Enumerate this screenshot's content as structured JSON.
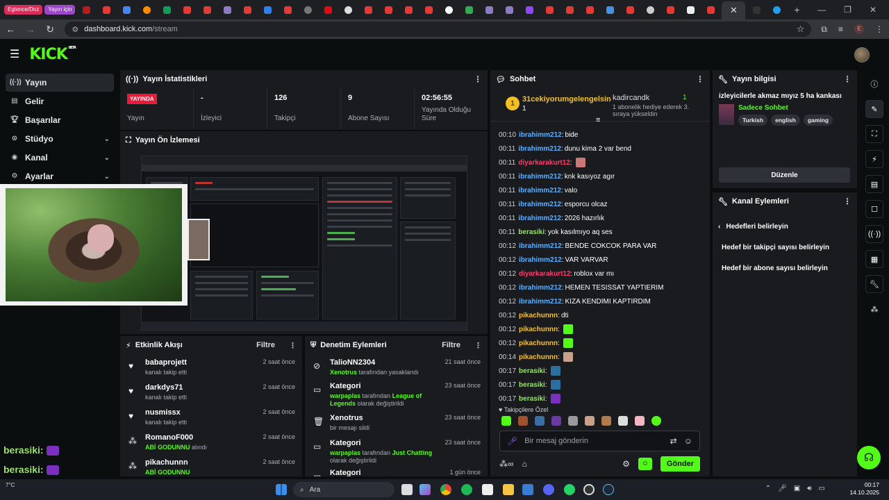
{
  "browser": {
    "tab_pills": [
      {
        "label": "Eglence/Doz",
        "color": "#d62d5b"
      },
      {
        "label": "Yayın için",
        "color": "#9c46c8"
      }
    ],
    "active_tab_label": "✕",
    "url_host": "dashboard.kick.com",
    "url_path": "/stream",
    "profile_initial": "E"
  },
  "sidebar": {
    "items": [
      {
        "label": "Yayın",
        "icon": "broadcast-icon"
      },
      {
        "label": "Gelir",
        "icon": "income-icon"
      },
      {
        "label": "Başarılar",
        "icon": "trophy-icon"
      },
      {
        "label": "Stüdyo",
        "icon": "studio-icon"
      },
      {
        "label": "Kanal",
        "icon": "channel-icon"
      },
      {
        "label": "Ayarlar",
        "icon": "gear-icon"
      }
    ]
  },
  "stats": {
    "title": "Yayın İstatistikleri",
    "live_badge": "YAYINDA",
    "live_label": "Yayın",
    "viewers_value": "-",
    "viewers_label": "İzleyici",
    "followers_value": "126",
    "followers_label": "Takipçi",
    "subs_value": "9",
    "subs_label": "Abone Sayısı",
    "uptime_value": "02:56:55",
    "uptime_label": "Yayında Olduğu Süre"
  },
  "preview": {
    "title": "Yayın Ön İzlemesi"
  },
  "activity": {
    "title": "Etkinlik Akışı",
    "filter": "Filtre",
    "items": [
      {
        "user": "babaprojett",
        "text": "kanalı takip etti",
        "highlight": "",
        "time": "2 saat önce",
        "icon": "heart-icon"
      },
      {
        "user": "darkdys71",
        "text": "kanalı takip etti",
        "highlight": "",
        "time": "2 saat önce",
        "icon": "heart-icon"
      },
      {
        "user": "nusmissx",
        "text": "kanalı takip etti",
        "highlight": "",
        "time": "2 saat önce",
        "icon": "heart-icon"
      },
      {
        "user": "RomanoF000",
        "text": "alındı",
        "highlight": "ABİ GODUNNU",
        "time": "2 saat önce",
        "icon": "points-icon"
      },
      {
        "user": "pikachunnn",
        "text": "",
        "highlight": "ABİ GODUNNU",
        "time": "2 saat önce",
        "icon": "points-icon"
      }
    ]
  },
  "moderation": {
    "title": "Denetim Eylemleri",
    "filter": "Filtre",
    "items": [
      {
        "user": "TalioNN2304",
        "pre": "",
        "hl1": "Xenotrus",
        "mid": "tarafından yasaklandı",
        "hl2": "",
        "post": "",
        "time": "21 saat önce",
        "icon": "ban-icon"
      },
      {
        "user": "Kategori",
        "pre": "",
        "hl1": "warpaplas",
        "mid": "tarafından",
        "hl2": "League of Legends",
        "post": "olarak değiştirildi",
        "time": "23 saat önce",
        "icon": "category-icon"
      },
      {
        "user": "Xenotrus",
        "pre": "bir mesajı sildi",
        "hl1": "",
        "mid": "",
        "hl2": "",
        "post": "",
        "time": "23 saat önce",
        "icon": "trash-icon"
      },
      {
        "user": "Kategori",
        "pre": "",
        "hl1": "warpaplas",
        "mid": "tarafından",
        "hl2": "Just Chatting",
        "post": "olarak değiştirildi",
        "time": "23 saat önce",
        "icon": "category-icon"
      },
      {
        "user": "Kategori",
        "pre": "",
        "hl1": "",
        "mid": "",
        "hl2": "",
        "post": "",
        "time": "1 gün önce",
        "icon": "category-icon"
      }
    ]
  },
  "chat": {
    "title": "Sohbet",
    "pinned": {
      "rank": "1",
      "user": "31cekiyorumgelengelsin",
      "level": "1",
      "gift_user": "kadircandk",
      "gift_level": "1",
      "gift_text": "1 abonelik hediye ederek 3. sıraya yükseldin"
    },
    "messages": [
      {
        "time": "00:10",
        "user": "ibrahimm212",
        "color": "#5ab0ff",
        "text": "bide",
        "emote": ""
      },
      {
        "time": "00:11",
        "user": "ibrahimm212",
        "color": "#5ab0ff",
        "text": "dunu kima 2 var bend",
        "emote": ""
      },
      {
        "time": "00:11",
        "user": "diyarkarakurt12",
        "color": "#ff3b6b",
        "text": "",
        "emote": "#c77"
      },
      {
        "time": "00:11",
        "user": "ibrahimm212",
        "color": "#5ab0ff",
        "text": "knk kasıyoz agır",
        "emote": ""
      },
      {
        "time": "00:11",
        "user": "ibrahimm212",
        "color": "#5ab0ff",
        "text": "valo",
        "emote": ""
      },
      {
        "time": "00:11",
        "user": "ibrahimm212",
        "color": "#5ab0ff",
        "text": "esporcu olcaz",
        "emote": ""
      },
      {
        "time": "00:11",
        "user": "ibrahimm212",
        "color": "#5ab0ff",
        "text": "2026 hazırlık",
        "emote": ""
      },
      {
        "time": "00:11",
        "user": "berasiki",
        "color": "#9be36a",
        "text": "yok kasılmıyo aq ses",
        "emote": ""
      },
      {
        "time": "00:12",
        "user": "ibrahimm212",
        "color": "#5ab0ff",
        "text": "BENDE COKCOK PARA VAR",
        "emote": ""
      },
      {
        "time": "00:12",
        "user": "ibrahimm212",
        "color": "#5ab0ff",
        "text": "VAR VARVAR",
        "emote": ""
      },
      {
        "time": "00:12",
        "user": "diyarkarakurt12",
        "color": "#ff3b6b",
        "text": "roblox var mı",
        "emote": ""
      },
      {
        "time": "00:12",
        "user": "ibrahimm212",
        "color": "#5ab0ff",
        "text": "HEMEN TESISSAT YAPTIERIM",
        "emote": ""
      },
      {
        "time": "00:12",
        "user": "ibrahimm212",
        "color": "#5ab0ff",
        "text": "KIZA KENDIMI KAPTIRDIM",
        "emote": ""
      },
      {
        "time": "00:12",
        "user": "pikachunnn",
        "color": "#f5c023",
        "text": "dti",
        "emote": ""
      },
      {
        "time": "00:12",
        "user": "pikachunnn",
        "color": "#f5c023",
        "text": "",
        "emote": "#53fc18"
      },
      {
        "time": "00:12",
        "user": "pikachunnn",
        "color": "#f5c023",
        "text": "",
        "emote": "#53fc18"
      },
      {
        "time": "00:14",
        "user": "pikachunnn",
        "color": "#f5c023",
        "text": "",
        "emote": "#c9a08a"
      },
      {
        "time": "00:17",
        "user": "berasiki",
        "color": "#9be36a",
        "text": "",
        "emote": "#2a6fa0"
      },
      {
        "time": "00:17",
        "user": "berasiki",
        "color": "#9be36a",
        "text": "",
        "emote": "#2a6fa0"
      },
      {
        "time": "00:17",
        "user": "berasiki",
        "color": "#9be36a",
        "text": "",
        "emote": "#7b2fbf"
      }
    ],
    "emote_label": "Takipçilere Özel",
    "input_placeholder": "Bir mesaj gönderin",
    "send_label": "Gönder"
  },
  "stream_info": {
    "title": "Yayın bilgisi",
    "stream_title": "izleyicilerle akmaz mıyız 5 ha kankası",
    "category": "Sadece Sohbet",
    "tags": [
      "Turkish",
      "english",
      "gaming"
    ],
    "edit_label": "Düzenle"
  },
  "channel_actions": {
    "title": "Kanal Eylemleri",
    "back_label": "Hedefleri belirleyin",
    "items": [
      "Hedef bir takipçi sayısı belirleyin",
      "Hedef bir abone sayısı belirleyin"
    ]
  },
  "overlay_chat": {
    "name": "berasiki:"
  },
  "taskbar": {
    "search_placeholder": "Ara",
    "time": "00:17",
    "date": "14.10.2025",
    "weather": "7°C"
  },
  "colors": {
    "brand": "#53fc18",
    "live": "#e51c3a"
  }
}
